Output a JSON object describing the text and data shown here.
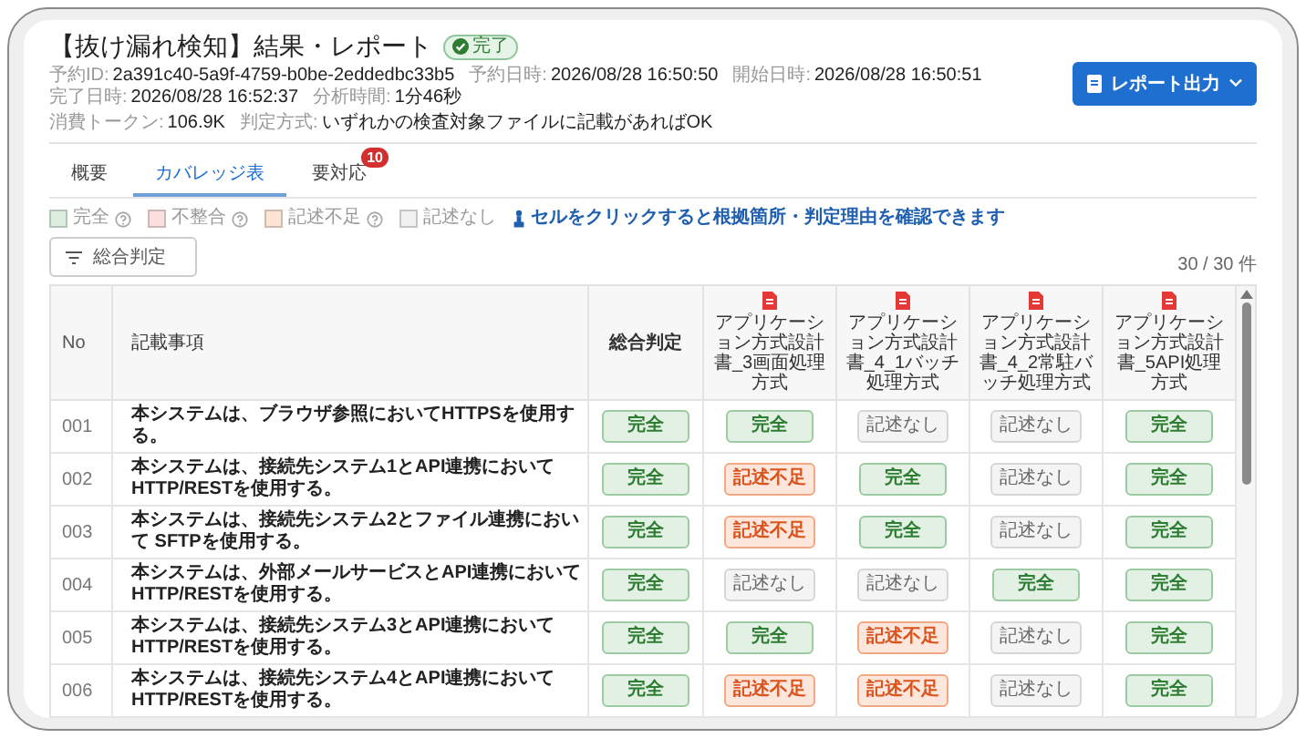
{
  "header": {
    "title": "【抜け漏れ検知】結果・レポート",
    "status": {
      "label": "完了",
      "kind": "done"
    },
    "meta_rows": [
      [
        {
          "label": "予約ID:",
          "value": "2a391c40-5a9f-4759-b0be-2eddedbc33b5"
        },
        {
          "label": "予約日時:",
          "value": "2026/08/28 16:50:50"
        },
        {
          "label": "開始日時:",
          "value": "2026/08/28 16:50:51"
        },
        {
          "label": "完了日時:",
          "value": "2026/08/28 16:52:37"
        },
        {
          "label": "分析時間:",
          "value": "1分46秒"
        }
      ],
      [
        {
          "label": "消費トークン:",
          "value": "106.9K"
        },
        {
          "label": "判定方式:",
          "value": "いずれかの検査対象ファイルに記載があればOK"
        }
      ]
    ],
    "export_button": "レポート出力"
  },
  "tabs": [
    {
      "label": "概要",
      "selected": false
    },
    {
      "label": "カバレッジ表",
      "selected": true
    },
    {
      "label": "要対応",
      "selected": false,
      "badge": "10"
    }
  ],
  "legend": {
    "items": [
      {
        "label": "完全",
        "color": "#dcefdf",
        "help": true
      },
      {
        "label": "不整合",
        "color": "#fbdede",
        "help": true
      },
      {
        "label": "記述不足",
        "color": "#fde3d3",
        "help": true
      },
      {
        "label": "記述なし",
        "color": "#f1f1f1",
        "help": false
      }
    ],
    "hint": "セルをクリックすると根拠箇所・判定理由を確認できます"
  },
  "filter_button": "総合判定",
  "count": "30 / 30 件",
  "table": {
    "columns": [
      "No",
      "記載事項",
      "総合判定"
    ],
    "documents": [
      "アプリケーション方式設計書_3画面処理方式",
      "アプリケーション方式設計書_4_1バッチ処理方式",
      "アプリケーション方式設計書_4_2常駐バッチ処理方式",
      "アプリケーション方式設計書_5API処理方式"
    ],
    "rows": [
      {
        "no": "001",
        "item": "本システムは、ブラウザ参照においてHTTPSを使用する。",
        "overall": {
          "label": "完全",
          "kind": "complete"
        },
        "docs": [
          {
            "label": "完全",
            "kind": "complete"
          },
          {
            "label": "記述なし",
            "kind": "none"
          },
          {
            "label": "記述なし",
            "kind": "none"
          },
          {
            "label": "完全",
            "kind": "complete"
          }
        ]
      },
      {
        "no": "002",
        "item": "本システムは、接続先システム1とAPI連携において HTTP/RESTを使用する。",
        "overall": {
          "label": "完全",
          "kind": "complete"
        },
        "docs": [
          {
            "label": "記述不足",
            "kind": "insufficient"
          },
          {
            "label": "完全",
            "kind": "complete"
          },
          {
            "label": "記述なし",
            "kind": "none"
          },
          {
            "label": "完全",
            "kind": "complete"
          }
        ]
      },
      {
        "no": "003",
        "item": "本システムは、接続先システム2とファイル連携において SFTPを使用する。",
        "overall": {
          "label": "完全",
          "kind": "complete"
        },
        "docs": [
          {
            "label": "記述不足",
            "kind": "insufficient"
          },
          {
            "label": "完全",
            "kind": "complete"
          },
          {
            "label": "記述なし",
            "kind": "none"
          },
          {
            "label": "完全",
            "kind": "complete"
          }
        ]
      },
      {
        "no": "004",
        "item": "本システムは、外部メールサービスとAPI連携において HTTP/RESTを使用する。",
        "overall": {
          "label": "完全",
          "kind": "complete"
        },
        "docs": [
          {
            "label": "記述なし",
            "kind": "none"
          },
          {
            "label": "記述なし",
            "kind": "none"
          },
          {
            "label": "完全",
            "kind": "complete"
          },
          {
            "label": "完全",
            "kind": "complete"
          }
        ]
      },
      {
        "no": "005",
        "item": "本システムは、接続先システム3とAPI連携において HTTP/RESTを使用する。",
        "overall": {
          "label": "完全",
          "kind": "complete"
        },
        "docs": [
          {
            "label": "完全",
            "kind": "complete"
          },
          {
            "label": "記述不足",
            "kind": "insufficient"
          },
          {
            "label": "記述なし",
            "kind": "none"
          },
          {
            "label": "完全",
            "kind": "complete"
          }
        ]
      },
      {
        "no": "006",
        "item": "本システムは、接続先システム4とAPI連携において HTTP/RESTを使用する。",
        "overall": {
          "label": "完全",
          "kind": "complete"
        },
        "docs": [
          {
            "label": "記述不足",
            "kind": "insufficient"
          },
          {
            "label": "記述不足",
            "kind": "insufficient"
          },
          {
            "label": "記述なし",
            "kind": "none"
          },
          {
            "label": "完全",
            "kind": "complete"
          }
        ]
      }
    ]
  }
}
